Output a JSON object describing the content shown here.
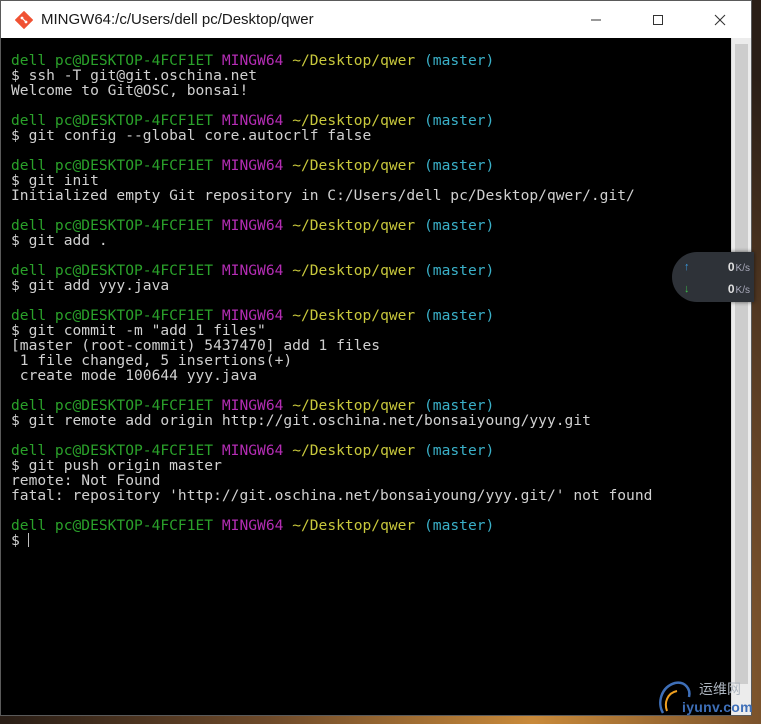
{
  "window": {
    "title": "MINGW64:/c/Users/dell pc/Desktop/qwer",
    "controls": {
      "minimize": "—",
      "maximize": "☐",
      "close": "✕"
    }
  },
  "terminal": {
    "prompt": {
      "user_host": "dell pc@DESKTOP-4FCF1ET",
      "shell": "MINGW64",
      "path": "~/Desktop/qwer",
      "branch": "(master)"
    },
    "lines": [
      {
        "kind": "prompt"
      },
      {
        "kind": "cmd",
        "text": "$ ssh -T git@git.oschina.net"
      },
      {
        "kind": "out",
        "text": "Welcome to Git@OSC, bonsai!"
      },
      {
        "kind": "blank"
      },
      {
        "kind": "prompt"
      },
      {
        "kind": "cmd",
        "text": "$ git config --global core.autocrlf false"
      },
      {
        "kind": "blank"
      },
      {
        "kind": "prompt"
      },
      {
        "kind": "cmd",
        "text": "$ git init"
      },
      {
        "kind": "out",
        "text": "Initialized empty Git repository in C:/Users/dell pc/Desktop/qwer/.git/"
      },
      {
        "kind": "blank"
      },
      {
        "kind": "prompt"
      },
      {
        "kind": "cmd",
        "text": "$ git add ."
      },
      {
        "kind": "blank"
      },
      {
        "kind": "prompt"
      },
      {
        "kind": "cmd",
        "text": "$ git add yyy.java"
      },
      {
        "kind": "blank"
      },
      {
        "kind": "prompt"
      },
      {
        "kind": "cmd",
        "text": "$ git commit -m \"add 1 files\""
      },
      {
        "kind": "out",
        "text": "[master (root-commit) 5437470] add 1 files"
      },
      {
        "kind": "out",
        "text": " 1 file changed, 5 insertions(+)"
      },
      {
        "kind": "out",
        "text": " create mode 100644 yyy.java"
      },
      {
        "kind": "blank"
      },
      {
        "kind": "prompt"
      },
      {
        "kind": "cmd",
        "text": "$ git remote add origin http://git.oschina.net/bonsaiyoung/yyy.git"
      },
      {
        "kind": "blank"
      },
      {
        "kind": "prompt"
      },
      {
        "kind": "cmd",
        "text": "$ git push origin master"
      },
      {
        "kind": "out",
        "text": "remote: Not Found"
      },
      {
        "kind": "out",
        "text": "fatal: repository 'http://git.oschina.net/bonsaiyoung/yyy.git/' not found"
      },
      {
        "kind": "blank"
      },
      {
        "kind": "prompt"
      },
      {
        "kind": "input",
        "text": "$"
      }
    ]
  },
  "net_speed": {
    "upload": {
      "value": "0",
      "unit": "K/s",
      "arrow": "↑"
    },
    "download": {
      "value": "0",
      "unit": "K/s",
      "arrow": "↓"
    }
  },
  "watermark": {
    "cn": "运维网",
    "en": "iyunv.com"
  },
  "colors": {
    "user_host": "#2aa12a",
    "shell": "#b42db4",
    "path": "#c8c83c",
    "branch": "#3ab0c8",
    "text": "#c8c8c8",
    "background": "#000000"
  }
}
